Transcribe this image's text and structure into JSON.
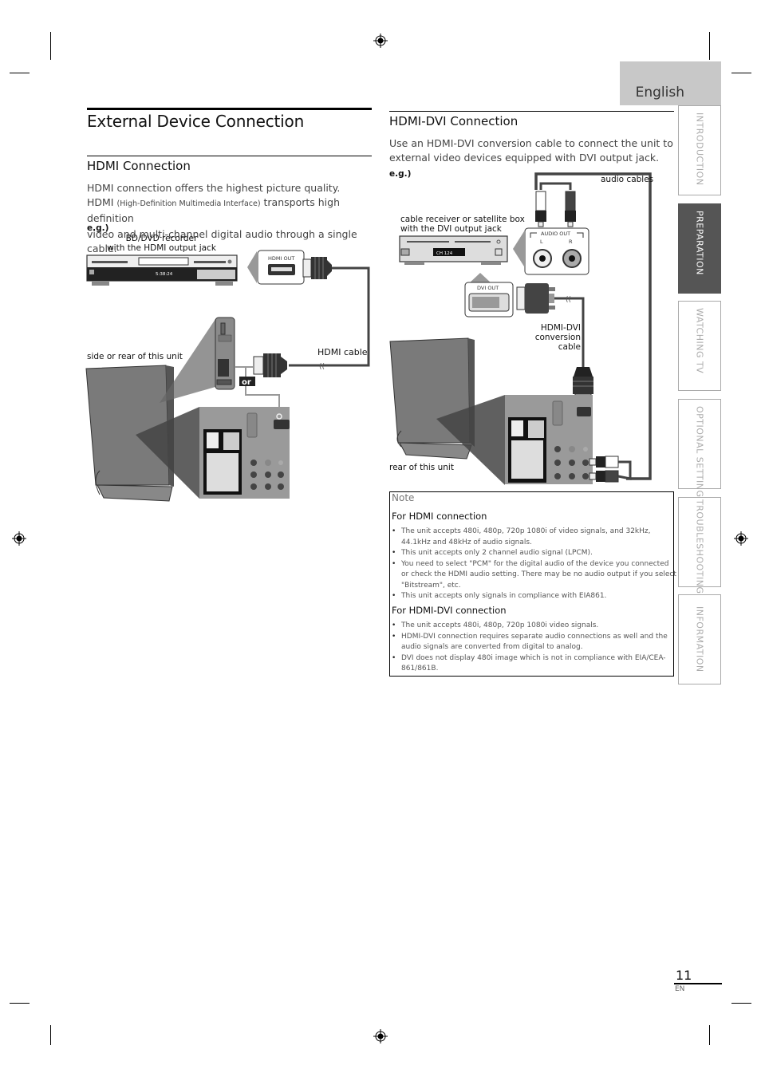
{
  "header": {
    "language_tab": "English"
  },
  "page_title": "External Device Connection",
  "side_tabs": [
    {
      "label": "INTRODUCTION",
      "active": false
    },
    {
      "label": "PREPARATION",
      "active": true
    },
    {
      "label": "WATCHING TV",
      "active": false
    },
    {
      "label": "OPTIONAL SETTING",
      "active": false
    },
    {
      "label": "TROUBLESHOOTING",
      "active": false
    },
    {
      "label": "INFORMATION",
      "active": false
    }
  ],
  "hdmi_section": {
    "heading": "HDMI Connection",
    "line1": "HDMI connection offers the highest picture quality.",
    "line2_prefix": "HDMI ",
    "line2_small": "(High-Definition Multimedia Interface)",
    "line2_suffix": " transports high definition",
    "line3": "video and multi-channel digital audio through a single cable.",
    "eg": "e.g.)",
    "diagram": {
      "device_label_line1": "BD/DVD recorder",
      "device_label_line2": "with the HDMI output jack",
      "display_readout": "5:38:24",
      "port_label": "HDMI OUT",
      "unit_label": "side or rear of this unit",
      "cable_label": "HDMI cable",
      "or_badge": "or"
    }
  },
  "hdmi_dvi_section": {
    "heading": "HDMI-DVI Connection",
    "line1": "Use an HDMI-DVI conversion cable to connect the unit to",
    "line2": "external video devices equipped with DVI output jack.",
    "eg": "e.g.)",
    "diagram": {
      "audio_cables_label": "audio cables",
      "device_label_line1": "cable receiver or satellite box",
      "device_label_line2": "with the DVI output jack",
      "display_readout": "CH 124",
      "audio_out_label": "AUDIO OUT",
      "audio_left": "L",
      "audio_right": "R",
      "dvi_out_label": "DVI OUT",
      "conversion_label_line1": "HDMI-DVI",
      "conversion_label_line2": "conversion cable",
      "unit_label": "rear of this unit"
    }
  },
  "note": {
    "title": "Note",
    "hdmi_heading": "For HDMI connection",
    "hdmi_items": [
      "The unit accepts 480i, 480p, 720p 1080i of video signals, and 32kHz, 44.1kHz and 48kHz of audio signals.",
      "This unit accepts only 2 channel audio signal (LPCM).",
      "You need to select \"PCM\" for the digital audio of the device you connected or check the HDMI audio setting. There may be no audio output if you select \"Bitstream\", etc.",
      "This unit accepts only signals in compliance with EIA861."
    ],
    "dvi_heading": "For HDMI-DVI connection",
    "dvi_items": [
      "The unit accepts 480i, 480p, 720p 1080i video signals.",
      "HDMI-DVI connection requires separate audio connections as well and the audio signals are converted from digital to analog.",
      "DVI does not display 480i image which is not in compliance with EIA/CEA-861/861B."
    ]
  },
  "footer": {
    "page_number": "11",
    "language_code": "EN"
  }
}
